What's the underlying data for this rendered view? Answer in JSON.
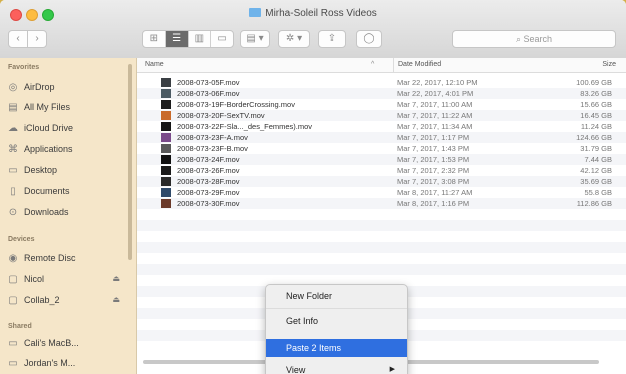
{
  "window": {
    "title": "Mirha-Soleil Ross Videos",
    "search_placeholder": "Search",
    "nav_back": "‹",
    "nav_forward": "›"
  },
  "sidebar": {
    "favorites_heading": "Favorites",
    "favorites": [
      {
        "label": "AirDrop",
        "icon": "airdrop-icon",
        "glyph": "◎"
      },
      {
        "label": "All My Files",
        "icon": "all-files-icon",
        "glyph": "▤"
      },
      {
        "label": "iCloud Drive",
        "icon": "cloud-icon",
        "glyph": "☁"
      },
      {
        "label": "Applications",
        "icon": "applications-icon",
        "glyph": "⌘"
      },
      {
        "label": "Desktop",
        "icon": "desktop-icon",
        "glyph": "▭"
      },
      {
        "label": "Documents",
        "icon": "documents-icon",
        "glyph": "▯"
      },
      {
        "label": "Downloads",
        "icon": "downloads-icon",
        "glyph": "⊙"
      }
    ],
    "devices_heading": "Devices",
    "devices": [
      {
        "label": "Remote Disc",
        "icon": "disc-icon",
        "glyph": "◉",
        "eject": false
      },
      {
        "label": "Nicol",
        "icon": "drive-icon",
        "glyph": "▢",
        "eject": true
      },
      {
        "label": "Collab_2",
        "icon": "drive-icon",
        "glyph": "▢",
        "eject": true
      }
    ],
    "shared_heading": "Shared",
    "shared": [
      {
        "label": "Cali's MacB...",
        "icon": "computer-icon",
        "glyph": "▭"
      },
      {
        "label": "Jordan's M...",
        "icon": "computer-icon",
        "glyph": "▭"
      }
    ]
  },
  "columns": {
    "name": "Name",
    "date": "Date Modified",
    "size": "Size",
    "sort_indicator": "^"
  },
  "files": [
    {
      "name": "2008-073-05F.mov",
      "date": "Mar 22, 2017, 12:10 PM",
      "size": "100.69 GB",
      "thumb": "#3a3f44"
    },
    {
      "name": "2008-073-06F.mov",
      "date": "Mar 22, 2017, 4:01 PM",
      "size": "83.26 GB",
      "thumb": "#4b5a63"
    },
    {
      "name": "2008-073-19F-BorderCrossing.mov",
      "date": "Mar 7, 2017, 11:00 AM",
      "size": "15.66 GB",
      "thumb": "#1c1c1c"
    },
    {
      "name": "2008-073-20F-SexTV.mov",
      "date": "Mar 7, 2017, 11:22 AM",
      "size": "16.45 GB",
      "thumb": "#c96a2a"
    },
    {
      "name": "2008-073-22F-Sla..._des_Femmes).mov",
      "date": "Mar 7, 2017, 11:34 AM",
      "size": "11.24 GB",
      "thumb": "#151515"
    },
    {
      "name": "2008-073-23F-A.mov",
      "date": "Mar 7, 2017, 1:17 PM",
      "size": "124.66 GB",
      "thumb": "#7a4a8a"
    },
    {
      "name": "2008-073-23F-B.mov",
      "date": "Mar 7, 2017, 1:43 PM",
      "size": "31.79 GB",
      "thumb": "#5a5a5a"
    },
    {
      "name": "2008-073-24F.mov",
      "date": "Mar 7, 2017, 1:53 PM",
      "size": "7.44 GB",
      "thumb": "#111111"
    },
    {
      "name": "2008-073-26F.mov",
      "date": "Mar 7, 2017, 2:32 PM",
      "size": "42.12 GB",
      "thumb": "#1a1a1a"
    },
    {
      "name": "2008-073-28F.mov",
      "date": "Mar 7, 2017, 3:08 PM",
      "size": "35.69 GB",
      "thumb": "#2a2a2a"
    },
    {
      "name": "2008-073-29F.mov",
      "date": "Mar 8, 2017, 11:27 AM",
      "size": "55.8 GB",
      "thumb": "#2f4a6a"
    },
    {
      "name": "2008-073-30F.mov",
      "date": "Mar 8, 2017, 1:16 PM",
      "size": "112.86 GB",
      "thumb": "#6a3a2a"
    }
  ],
  "context_menu": {
    "items": [
      {
        "label": "New Folder",
        "highlighted": false,
        "submenu": false
      },
      {
        "label": "Get Info",
        "highlighted": false,
        "submenu": false
      },
      {
        "label": "Paste 2 Items",
        "highlighted": true,
        "submenu": false
      },
      {
        "label": "View",
        "highlighted": false,
        "submenu": true
      }
    ]
  },
  "colors": {
    "sidebar_bg": "#f5e6c9",
    "highlight": "#2f6fe0",
    "desktop": "#d4b04a"
  }
}
